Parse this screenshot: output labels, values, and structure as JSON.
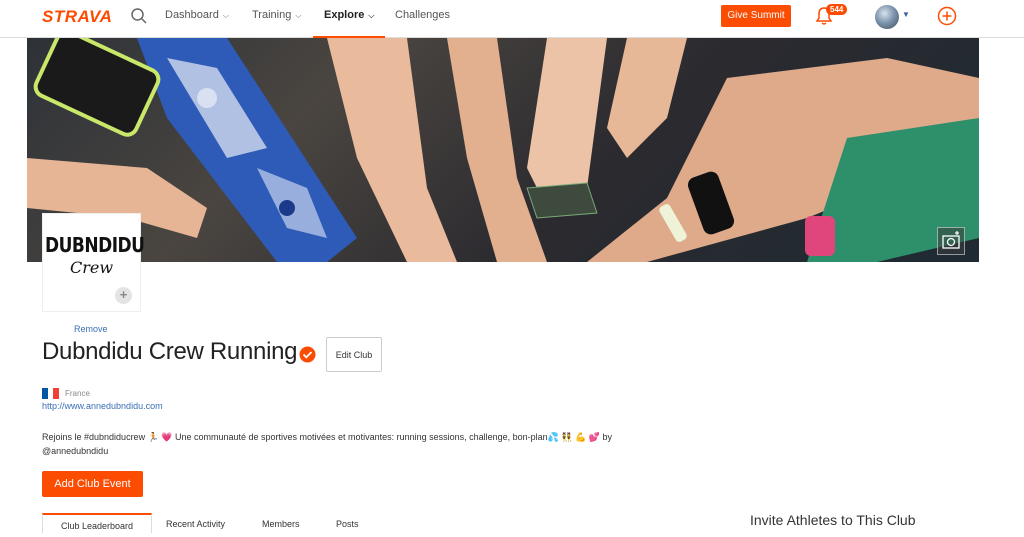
{
  "nav": {
    "logo": "STRAVA",
    "dashboard": "Dashboard",
    "training": "Training",
    "explore": "Explore",
    "challenges": "Challenges",
    "give_summit": "Give Summit",
    "notification_count": "544"
  },
  "club": {
    "avatar_line1": "DUBNDIDU",
    "avatar_line2": "Crew",
    "remove_label": "Remove",
    "name": "Dubndidu Crew Running",
    "edit_label": "Edit Club",
    "country": "France",
    "website": "http://www.annedubndidu.com",
    "description_line1": "Rejoins le #dubndiducrew 🏃 💗 Une communauté de sportives motivées et motivantes: running sessions, challenge, bon-plan💦 👯 💪 💕 by",
    "description_line2": "@annedubndidu",
    "add_event_label": "Add Club Event"
  },
  "tabs": [
    {
      "label": "Club Leaderboard"
    },
    {
      "label": "Recent Activity"
    },
    {
      "label": "Members"
    },
    {
      "label": "Posts"
    }
  ],
  "sidebar": {
    "invite_title": "Invite Athletes to This Club"
  },
  "colors": {
    "brand": "#fc4c02",
    "link": "#3b6fb6"
  },
  "icons": [
    "search-icon",
    "bell-icon",
    "plus-circle-icon",
    "camera-icon",
    "verified-icon",
    "france-flag-icon"
  ]
}
